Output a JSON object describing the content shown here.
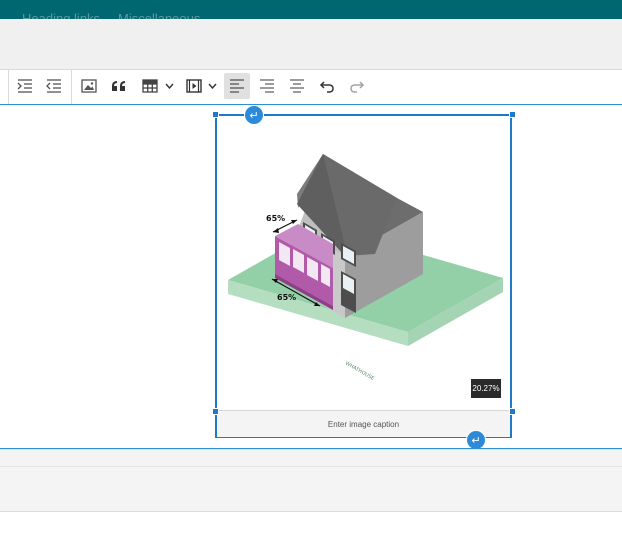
{
  "top_nav": {
    "items": [
      "Heading links",
      "Miscellaneous"
    ]
  },
  "toolbar": {
    "buttons": [
      {
        "name": "indent",
        "icon": "indent-icon"
      },
      {
        "name": "outdent",
        "icon": "outdent-icon"
      },
      {
        "name": "image",
        "icon": "image-icon"
      },
      {
        "name": "blockquote",
        "icon": "quote-icon"
      },
      {
        "name": "table",
        "icon": "table-icon",
        "dropdown": true
      },
      {
        "name": "media",
        "icon": "media-icon",
        "dropdown": true
      },
      {
        "name": "align-left",
        "icon": "align-left-icon",
        "active": true
      },
      {
        "name": "align-right",
        "icon": "align-right-icon"
      },
      {
        "name": "align-center",
        "icon": "align-center-icon"
      },
      {
        "name": "undo",
        "icon": "undo-icon"
      },
      {
        "name": "redo",
        "icon": "redo-icon",
        "disabled": true
      }
    ]
  },
  "image": {
    "resize_label": "20.27%",
    "caption_placeholder": "Enter image caption",
    "illustration_labels": [
      "65%",
      "65%"
    ],
    "illustration_watermark": "WHATHOUSE"
  },
  "colors": {
    "nav_bg": "#006770",
    "selection_blue": "#1f78c8",
    "badge_bg": "#2a2a2a"
  }
}
